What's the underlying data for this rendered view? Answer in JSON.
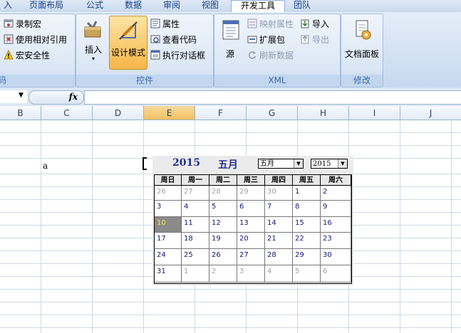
{
  "tabs": [
    {
      "label": "插入",
      "display": "入",
      "active": false
    },
    {
      "label": "页面布局",
      "active": false
    },
    {
      "label": "公式",
      "active": false
    },
    {
      "label": "数据",
      "active": false
    },
    {
      "label": "审阅",
      "active": false
    },
    {
      "label": "视图",
      "active": false
    },
    {
      "label": "开发工具",
      "active": true
    },
    {
      "label": "团队",
      "active": false
    }
  ],
  "ribbon": {
    "code_group": {
      "label": "代码",
      "label_visible": "码",
      "record_macro": "录制宏",
      "use_relative": "使用相对引用",
      "macro_security": "宏安全性"
    },
    "controls_group": {
      "label": "控件",
      "insert": "插入",
      "design_mode": "设计模式",
      "properties": "属性",
      "view_code": "查看代码",
      "run_dialog": "执行对话框"
    },
    "xml_group": {
      "label": "XML",
      "source": "源",
      "map_properties": "映射属性",
      "expansion_packs": "扩展包",
      "refresh_data": "刷新数据",
      "import": "导入",
      "export": "导出"
    },
    "modify_group": {
      "label": "修改",
      "doc_panel": "文档面板"
    }
  },
  "formula_bar": {
    "name_box": "",
    "fx_label": "fx",
    "content": ""
  },
  "columns": [
    "B",
    "C",
    "D",
    "E",
    "F",
    "G",
    "H",
    "I",
    "J"
  ],
  "selected_column": "E",
  "cells": {
    "c_row4": "a"
  },
  "calendar": {
    "year_title": "2015",
    "month_title": "五月",
    "month_select": "五月",
    "year_select": "2015",
    "weekdays": [
      "周日",
      "周一",
      "周二",
      "周三",
      "周四",
      "周五",
      "周六"
    ],
    "weeks": [
      [
        {
          "d": "26",
          "o": true
        },
        {
          "d": "27",
          "o": true
        },
        {
          "d": "28",
          "o": true
        },
        {
          "d": "29",
          "o": true
        },
        {
          "d": "30",
          "o": true
        },
        {
          "d": "1",
          "o": false
        },
        {
          "d": "2",
          "o": false
        }
      ],
      [
        {
          "d": "3",
          "o": false
        },
        {
          "d": "4",
          "o": false
        },
        {
          "d": "5",
          "o": false
        },
        {
          "d": "6",
          "o": false
        },
        {
          "d": "7",
          "o": false
        },
        {
          "d": "8",
          "o": false
        },
        {
          "d": "9",
          "o": false
        }
      ],
      [
        {
          "d": "10",
          "o": false,
          "today": true
        },
        {
          "d": "11",
          "o": false
        },
        {
          "d": "12",
          "o": false
        },
        {
          "d": "13",
          "o": false
        },
        {
          "d": "14",
          "o": false
        },
        {
          "d": "15",
          "o": false
        },
        {
          "d": "16",
          "o": false
        }
      ],
      [
        {
          "d": "17",
          "o": false
        },
        {
          "d": "18",
          "o": false
        },
        {
          "d": "19",
          "o": false
        },
        {
          "d": "20",
          "o": false
        },
        {
          "d": "21",
          "o": false
        },
        {
          "d": "22",
          "o": false
        },
        {
          "d": "23",
          "o": false
        }
      ],
      [
        {
          "d": "24",
          "o": false
        },
        {
          "d": "25",
          "o": false
        },
        {
          "d": "26",
          "o": false
        },
        {
          "d": "27",
          "o": false
        },
        {
          "d": "28",
          "o": false
        },
        {
          "d": "29",
          "o": false
        },
        {
          "d": "30",
          "o": false
        }
      ],
      [
        {
          "d": "31",
          "o": false
        },
        {
          "d": "1",
          "o": true
        },
        {
          "d": "2",
          "o": true
        },
        {
          "d": "3",
          "o": true
        },
        {
          "d": "4",
          "o": true
        },
        {
          "d": "5",
          "o": true
        },
        {
          "d": "6",
          "o": true
        }
      ]
    ]
  }
}
